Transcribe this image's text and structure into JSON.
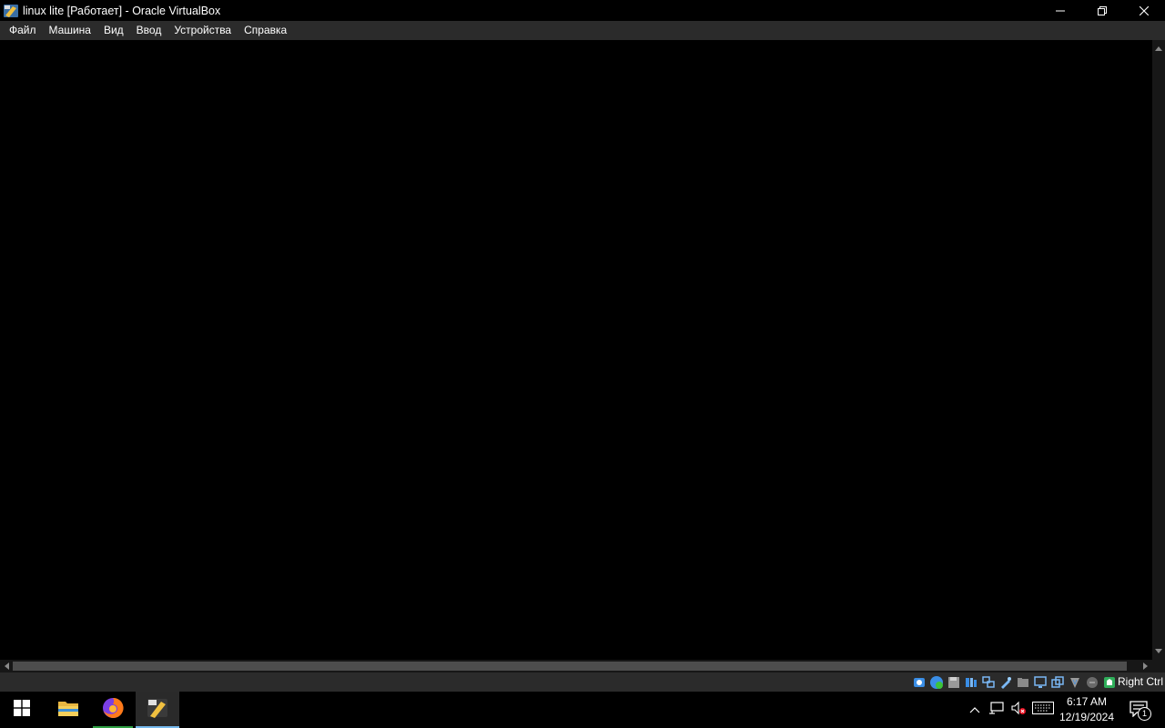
{
  "window": {
    "title": "linux lite [Работает] - Oracle VirtualBox",
    "controls": {
      "minimize": "minimize",
      "restore": "restore",
      "close": "close"
    }
  },
  "menu": {
    "items": [
      "Файл",
      "Машина",
      "Вид",
      "Ввод",
      "Устройства",
      "Справка"
    ]
  },
  "statusbar": {
    "icons": [
      "hard-disk-icon",
      "optical-drive-icon",
      "floppy-icon",
      "audio-icon",
      "network-icon",
      "usb-icon",
      "shared-folders-icon",
      "display-icon",
      "recording-icon",
      "capture-icon",
      "mouse-integration-icon",
      "keyboard-icon",
      "cpu-icon"
    ],
    "host_key": "Right Ctrl"
  },
  "taskbar": {
    "apps": [
      "windows-start-icon",
      "file-explorer-icon",
      "firefox-icon",
      "virtualbox-icon"
    ],
    "clock": {
      "time": "6:17 AM",
      "date": "12/19/2024"
    },
    "notifications_count": "1"
  },
  "colors": {
    "firefox_underline": "#2ea043",
    "virtualbox_underline": "#76b9ed",
    "accent": "#0078d7"
  }
}
